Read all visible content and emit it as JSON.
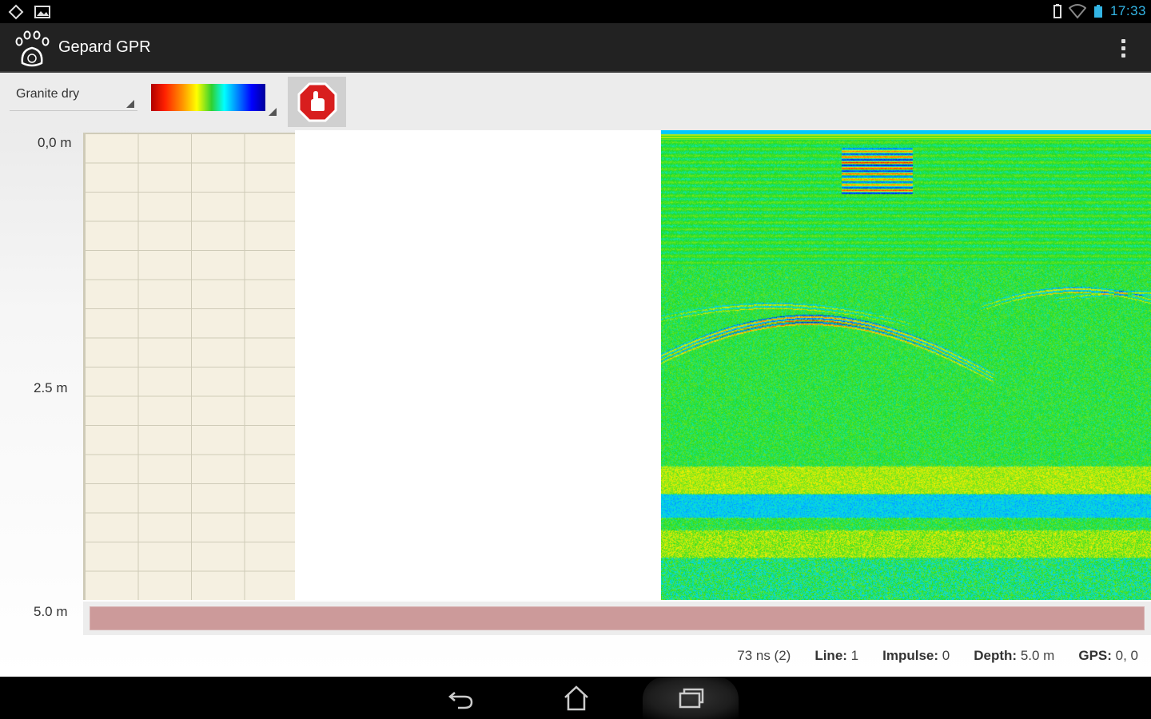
{
  "status_bar": {
    "time": "17:33",
    "left_icons": [
      "notification-icon",
      "image-icon"
    ],
    "right_icons": [
      "battery-icon",
      "wifi-icon",
      "signal-icon"
    ]
  },
  "action_bar": {
    "title": "Gepard GPR",
    "logo": "paw-logo-icon",
    "menu_icon": "overflow-menu-icon"
  },
  "toolbar": {
    "material": "Granite dry",
    "palette": "rainbow",
    "stop_icon": "stop-hand-icon",
    "stop_color": "#d81e1e"
  },
  "depth_axis": {
    "top": "0,0 m",
    "mid": "2.5 m",
    "bottom": "5.0 m"
  },
  "info": {
    "time": "73 ns  (2)",
    "line_label": "Line:",
    "line_value": "1",
    "impulse_label": "Impulse:",
    "impulse_value": "0",
    "depth_label": "Depth:",
    "depth_value": "5.0 m",
    "gps_label": "GPS:",
    "gps_value": "0, 0"
  },
  "navigation": {
    "back_icon": "back-icon",
    "home_icon": "home-icon",
    "recents_icon": "recents-icon"
  },
  "colors": {
    "accent": "#33b5e5",
    "scan_bar": "#cc9a9a",
    "grid_bg": "#f5f0e1"
  }
}
